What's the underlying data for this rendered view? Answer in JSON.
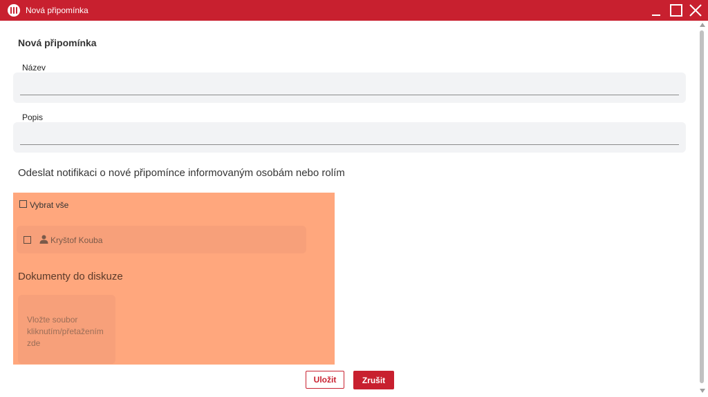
{
  "window": {
    "title": "Nová připomínka",
    "accent_color": "#c8202f",
    "controls": [
      "minimize-icon",
      "maximize-icon",
      "close-icon"
    ]
  },
  "form": {
    "heading": "Nová připomínka",
    "name_label": "Název",
    "name_value": "",
    "description_label": "Popis",
    "description_value": "",
    "notify_text": "Odeslat notifikaci o nové připomínce informovaným osobám nebo rolím"
  },
  "recipients": {
    "select_all_label": "Vybrat vše",
    "select_all_checked": false,
    "people": [
      {
        "name": "Kryštof Kouba",
        "checked": false,
        "icon": "person-icon"
      }
    ]
  },
  "documents": {
    "heading": "Dokumenty do diskuze",
    "dropzone_text": "Vložte soubor kliknutím/přetažením zde"
  },
  "actions": {
    "save_label": "Uložit",
    "cancel_label": "Zrušit"
  }
}
